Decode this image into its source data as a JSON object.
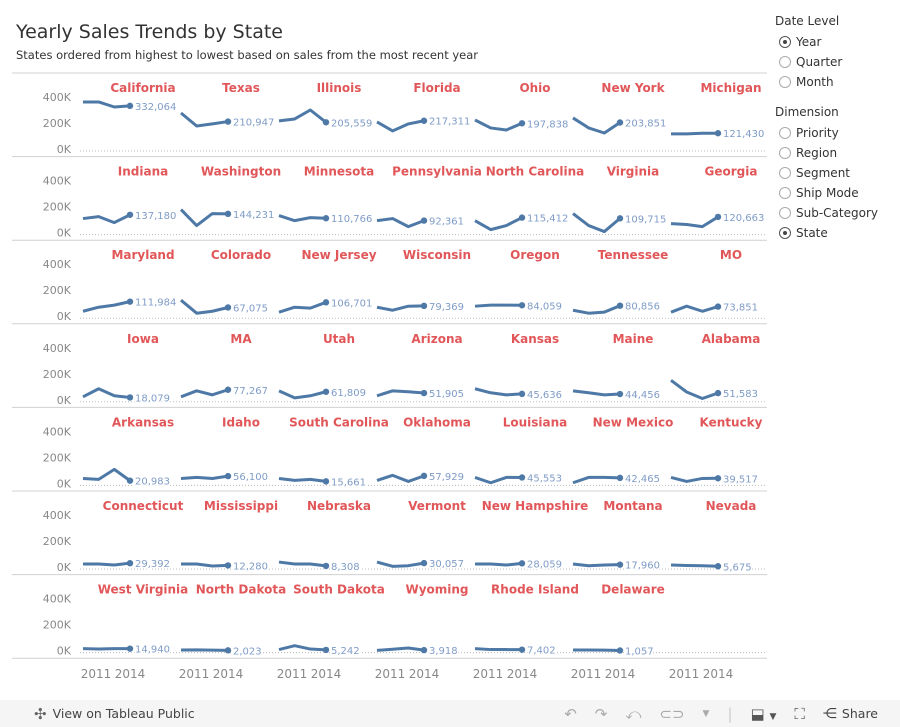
{
  "header": {
    "title": "Yearly Sales Trends by State",
    "subtitle": "States ordered from highest to lowest based on sales from the most recent year"
  },
  "colors": {
    "line": "#4e79a7",
    "title": "#e15759",
    "label": "#7f9cc7",
    "axis": "#888888"
  },
  "sidebar": {
    "date_level": {
      "label": "Date Level",
      "options": [
        {
          "label": "Year",
          "selected": true
        },
        {
          "label": "Quarter",
          "selected": false
        },
        {
          "label": "Month",
          "selected": false
        }
      ]
    },
    "dimension": {
      "label": "Dimension",
      "options": [
        {
          "label": "Priority",
          "selected": false
        },
        {
          "label": "Region",
          "selected": false
        },
        {
          "label": "Segment",
          "selected": false
        },
        {
          "label": "Ship Mode",
          "selected": false
        },
        {
          "label": "Sub-Category",
          "selected": false
        },
        {
          "label": "State",
          "selected": true
        }
      ]
    }
  },
  "footer": {
    "view_label": "View on Tableau Public",
    "share_label": "Share"
  },
  "chart_data": {
    "type": "line",
    "layout": "small-multiples",
    "years": [
      2011,
      2012,
      2013,
      2014
    ],
    "x_tick_labels": [
      "2011",
      "2014"
    ],
    "y_tick_labels": [
      "400K",
      "200K",
      "0K"
    ],
    "ylim": [
      0,
      400000
    ],
    "panels": [
      {
        "state": "California",
        "values": [
          362000,
          362000,
          323000,
          332064
        ],
        "label": "332,064"
      },
      {
        "state": "Texas",
        "values": [
          277000,
          177000,
          193000,
          210947
        ],
        "label": "210,947"
      },
      {
        "state": "Illinois",
        "values": [
          216000,
          231000,
          300000,
          205559
        ],
        "label": "205,559"
      },
      {
        "state": "Florida",
        "values": [
          208000,
          139000,
          193000,
          217311
        ],
        "label": "217,311"
      },
      {
        "state": "Ohio",
        "values": [
          223000,
          162000,
          146000,
          197838
        ],
        "label": "197,838"
      },
      {
        "state": "New York",
        "values": [
          239000,
          162000,
          123000,
          203851
        ],
        "label": "203,851"
      },
      {
        "state": "Michigan",
        "values": [
          116000,
          116000,
          121000,
          121430
        ],
        "label": "121,430"
      },
      {
        "state": "Indiana",
        "values": [
          108000,
          123000,
          77000,
          137180
        ],
        "label": "137,180"
      },
      {
        "state": "Washington",
        "values": [
          177000,
          54000,
          146000,
          144231
        ],
        "label": "144,231"
      },
      {
        "state": "Minnesota",
        "values": [
          131000,
          92000,
          115000,
          110766
        ],
        "label": "110,766"
      },
      {
        "state": "Pennsylvania",
        "values": [
          92000,
          108000,
          46000,
          92361
        ],
        "label": "92,361"
      },
      {
        "state": "North Carolina",
        "values": [
          92000,
          23000,
          54000,
          115412
        ],
        "label": "115,412"
      },
      {
        "state": "Virginia",
        "values": [
          146000,
          54000,
          8000,
          109715
        ],
        "label": "109,715"
      },
      {
        "state": "Georgia",
        "values": [
          69000,
          62000,
          46000,
          120663
        ],
        "label": "120,663"
      },
      {
        "state": "Maryland",
        "values": [
          38000,
          69000,
          85000,
          111984
        ],
        "label": "111,984"
      },
      {
        "state": "Colorado",
        "values": [
          123000,
          23000,
          38000,
          67075
        ],
        "label": "67,075"
      },
      {
        "state": "New Jersey",
        "values": [
          31000,
          69000,
          62000,
          106701
        ],
        "label": "106,701"
      },
      {
        "state": "Wisconsin",
        "values": [
          69000,
          46000,
          77000,
          79369
        ],
        "label": "79,369"
      },
      {
        "state": "Oregon",
        "values": [
          77000,
          85000,
          85000,
          84059
        ],
        "label": "84,059"
      },
      {
        "state": "Tennessee",
        "values": [
          46000,
          23000,
          31000,
          80856
        ],
        "label": "80,856"
      },
      {
        "state": "MO",
        "values": [
          31000,
          77000,
          38000,
          73851
        ],
        "label": "73,851"
      },
      {
        "state": "Iowa",
        "values": [
          23000,
          85000,
          31000,
          18079
        ],
        "label": "18,079"
      },
      {
        "state": "MA",
        "values": [
          23000,
          69000,
          38000,
          77267
        ],
        "label": "77,267"
      },
      {
        "state": "Utah",
        "values": [
          69000,
          15000,
          31000,
          61809
        ],
        "label": "61,809"
      },
      {
        "state": "Arizona",
        "values": [
          31000,
          69000,
          62000,
          51905
        ],
        "label": "51,905"
      },
      {
        "state": "Kansas",
        "values": [
          85000,
          54000,
          38000,
          45636
        ],
        "label": "45,636"
      },
      {
        "state": "Maine",
        "values": [
          69000,
          54000,
          38000,
          44456
        ],
        "label": "44,456"
      },
      {
        "state": "Alabama",
        "values": [
          150000,
          60000,
          10000,
          51583
        ],
        "label": "51,583"
      },
      {
        "state": "Arkansas",
        "values": [
          38000,
          31000,
          108000,
          20983
        ],
        "label": "20,983"
      },
      {
        "state": "Idaho",
        "values": [
          38000,
          46000,
          38000,
          56100
        ],
        "label": "56,100"
      },
      {
        "state": "South Carolina",
        "values": [
          38000,
          23000,
          31000,
          15661
        ],
        "label": "15,661"
      },
      {
        "state": "Oklahoma",
        "values": [
          23000,
          62000,
          15000,
          57929
        ],
        "label": "57,929"
      },
      {
        "state": "Louisiana",
        "values": [
          46000,
          5000,
          46000,
          45553
        ],
        "label": "45,553"
      },
      {
        "state": "New Mexico",
        "values": [
          5000,
          46000,
          46000,
          42465
        ],
        "label": "42,465"
      },
      {
        "state": "Kentucky",
        "values": [
          46000,
          15000,
          38000,
          39517
        ],
        "label": "39,517"
      },
      {
        "state": "Connecticut",
        "values": [
          23000,
          23000,
          15000,
          29392
        ],
        "label": "29,392"
      },
      {
        "state": "Mississippi",
        "values": [
          23000,
          23000,
          8000,
          12280
        ],
        "label": "12,280"
      },
      {
        "state": "Nebraska",
        "values": [
          38000,
          23000,
          23000,
          8308
        ],
        "label": "8,308"
      },
      {
        "state": "Vermont",
        "values": [
          38000,
          5000,
          10000,
          30057
        ],
        "label": "30,057"
      },
      {
        "state": "New Hampshire",
        "values": [
          23000,
          23000,
          15000,
          28059
        ],
        "label": "28,059"
      },
      {
        "state": "Montana",
        "values": [
          23000,
          10000,
          15000,
          17960
        ],
        "label": "17,960"
      },
      {
        "state": "Nevada",
        "values": [
          15000,
          12000,
          10000,
          5675
        ],
        "label": "5,675"
      },
      {
        "state": "West Virginia",
        "values": [
          15000,
          12000,
          15000,
          14940
        ],
        "label": "14,940"
      },
      {
        "state": "North Dakota",
        "values": [
          5000,
          6000,
          4000,
          2023
        ],
        "label": "2,023"
      },
      {
        "state": "South Dakota",
        "values": [
          8000,
          38000,
          12000,
          5242
        ],
        "label": "5,242"
      },
      {
        "state": "Wyoming",
        "values": [
          2000,
          10000,
          20000,
          3918
        ],
        "label": "3,918"
      },
      {
        "state": "Rhode Island",
        "values": [
          15000,
          8000,
          8000,
          7402
        ],
        "label": "7,402"
      },
      {
        "state": "Delaware",
        "values": [
          5000,
          5000,
          4000,
          1057
        ],
        "label": "1,057"
      }
    ]
  }
}
